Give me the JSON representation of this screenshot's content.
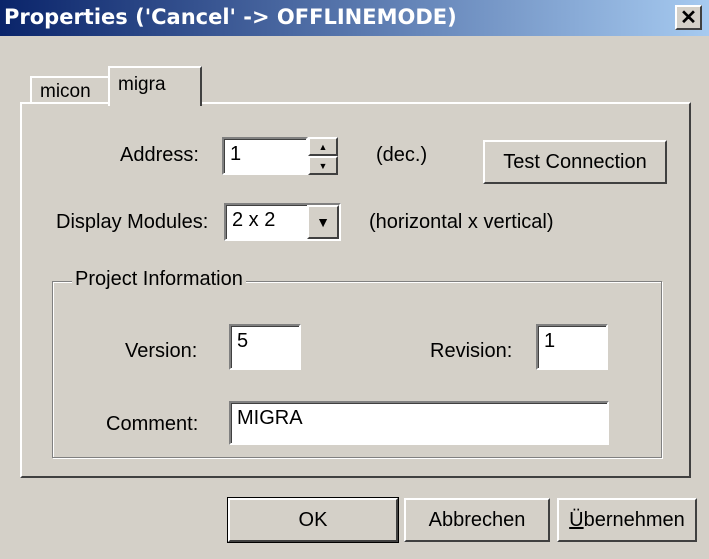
{
  "window": {
    "title": "Properties ('Cancel' -> OFFLINEMODE)",
    "close_glyph": "✕"
  },
  "tabs": [
    {
      "label": "micon",
      "selected": false
    },
    {
      "label": "migra",
      "selected": true
    }
  ],
  "address": {
    "label": "Address:",
    "value": "1",
    "unit": "(dec.)"
  },
  "test_connection": {
    "label": "Test Connection"
  },
  "display_modules": {
    "label": "Display Modules:",
    "value": "2 x 2",
    "hint": "(horizontal x vertical)"
  },
  "project_info": {
    "legend": "Project Information",
    "version_label": "Version:",
    "version_value": "5",
    "revision_label": "Revision:",
    "revision_value": "1",
    "comment_label": "Comment:",
    "comment_value": "MIGRA"
  },
  "footer": {
    "ok": "OK",
    "cancel": "Abbrechen",
    "apply_first": "Ü",
    "apply_rest": "bernehmen"
  },
  "icons": {
    "spin_up": "▲",
    "spin_down": "▼",
    "dropdown": "▼"
  }
}
